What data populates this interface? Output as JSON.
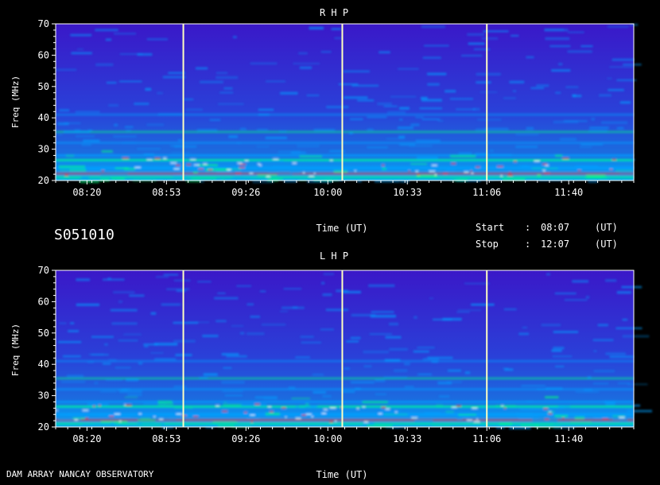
{
  "header": {
    "station_id": "S051010",
    "time_axis_label": "Time (UT)",
    "start_label": "Start",
    "stop_label": "Stop",
    "start_sep": ":",
    "stop_sep": ":",
    "start_time": "08:07",
    "stop_time": "12:07",
    "start_unit": "(UT)",
    "stop_unit": "(UT)"
  },
  "footer": {
    "observatory": "DAM ARRAY  NANCAY OBSERVATORY",
    "time_axis_label": "Time (UT)"
  },
  "colors": {
    "background": "#000000",
    "spectrum_low": "#2a1fb0",
    "spectrum_mid": "#00a0ff",
    "spectrum_high": "#00ff80",
    "spectrum_peak": "#ff2020",
    "marker_line": "#ffffc0"
  },
  "chart_data": [
    {
      "type": "heatmap",
      "title": "R H P",
      "ylabel": "Freq (MHz)",
      "xlabel": "",
      "ylim": [
        20,
        70
      ],
      "yticks": [
        20,
        30,
        40,
        50,
        60,
        70
      ],
      "xticks": [
        "08:20",
        "08:53",
        "09:26",
        "10:00",
        "10:33",
        "11:06",
        "11:40"
      ],
      "markers_ut": [
        "09:00",
        "10:06",
        "11:06"
      ]
    },
    {
      "type": "heatmap",
      "title": "L H P",
      "ylabel": "Freq (MHz)",
      "xlabel": "",
      "ylim": [
        20,
        70
      ],
      "yticks": [
        20,
        30,
        40,
        50,
        60,
        70
      ],
      "xticks": [
        "08:20",
        "08:53",
        "09:26",
        "10:00",
        "10:33",
        "11:06",
        "11:40"
      ],
      "markers_ut": [
        "09:00",
        "10:06",
        "11:06"
      ]
    }
  ]
}
